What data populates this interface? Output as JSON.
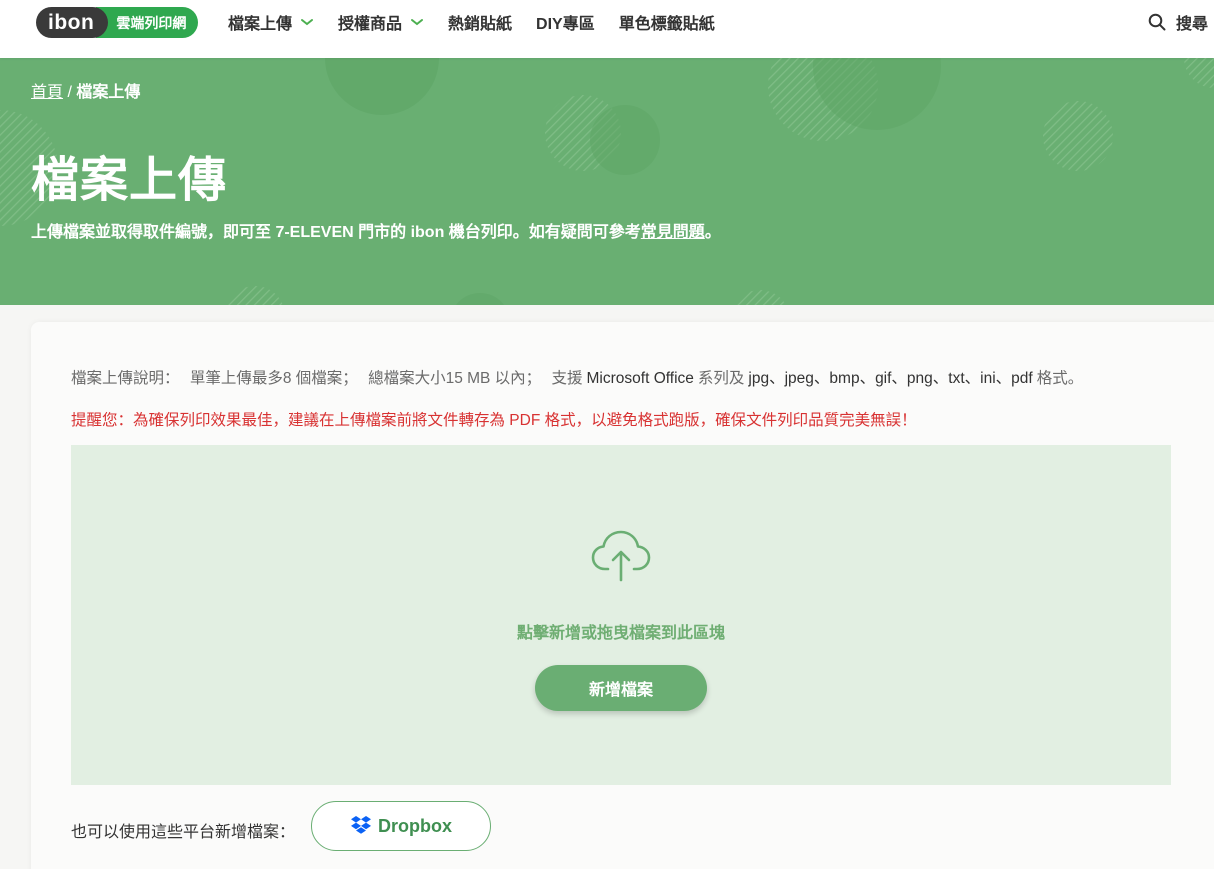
{
  "header": {
    "logo_text": "ibon",
    "logo_tag": "雲端列印網",
    "nav": [
      {
        "label": "檔案上傳",
        "has_dropdown": true
      },
      {
        "label": "授權商品",
        "has_dropdown": true
      },
      {
        "label": "熱銷貼紙",
        "has_dropdown": false
      },
      {
        "label": "DIY專區",
        "has_dropdown": false
      },
      {
        "label": "單色標籤貼紙",
        "has_dropdown": false
      }
    ],
    "search_label": "搜尋"
  },
  "hero": {
    "breadcrumb_home": "首頁",
    "breadcrumb_sep": "/",
    "breadcrumb_current": "檔案上傳",
    "title": "檔案上傳",
    "desc_prefix": "上傳檔案並取得取件編號，即可至 7-ELEVEN 門市的 ibon 機台列印。如有疑問可參考",
    "desc_link": "常見問題",
    "desc_suffix": "。"
  },
  "upload": {
    "info_label": "檔案上傳說明：",
    "info_count": "單筆上傳最多8 個檔案；",
    "info_size": "總檔案大小15 MB 以內；",
    "info_support_prefix": "支援",
    "info_formats": "Microsoft Office",
    "info_series": "系列及",
    "info_ext": "jpg、jpeg、bmp、gif、png、txt、ini、pdf",
    "info_suffix": "格式。",
    "warning": "提醒您：為確保列印效果最佳，建議在上傳檔案前將文件轉存為 PDF 格式，以避免格式跑版，確保文件列印品質完美無誤！",
    "drop_text": "點擊新增或拖曳檔案到此區塊",
    "add_button": "新增檔案",
    "platform_label": "也可以使用這些平台新增檔案：",
    "dropbox_label": "Dropbox"
  },
  "colors": {
    "brand_green": "#69af72",
    "logo_green": "#2fa84f",
    "warning_red": "#d83232",
    "dropzone_bg": "#e2efe2"
  },
  "icons": [
    "chevron-down-icon",
    "search-icon",
    "cloud-upload-icon",
    "dropbox-icon"
  ]
}
